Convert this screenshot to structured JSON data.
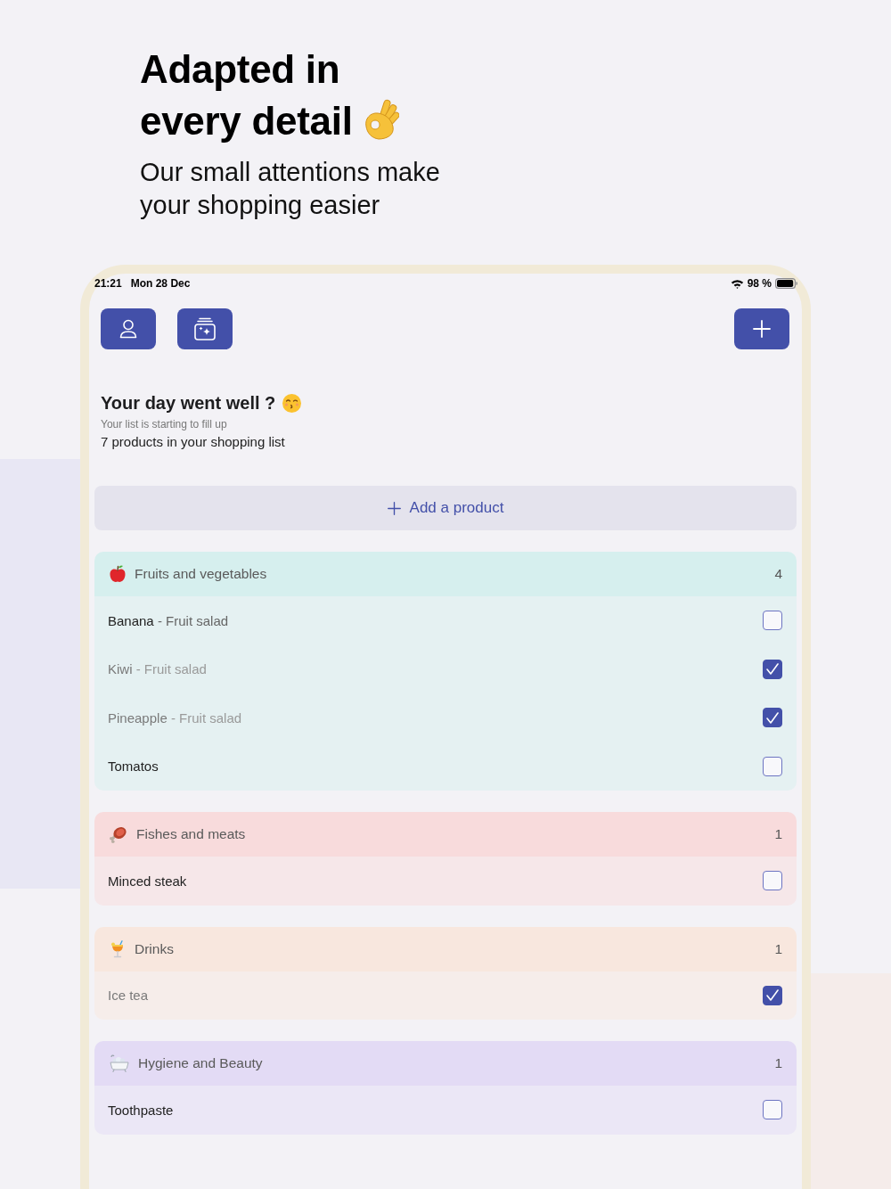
{
  "headline": {
    "title": "Adapted in every detail",
    "subtitle": "Our small attentions make your shopping easier"
  },
  "status_bar": {
    "time": "21:21",
    "date": "Mon 28 Dec",
    "battery": "98 %"
  },
  "greeting": {
    "title": "Your day went well ?",
    "subtitle": "Your list is starting to fill up",
    "summary": "7 products in your shopping list"
  },
  "add_button": {
    "label": "Add a product"
  },
  "categories": [
    {
      "name": "Fruits and vegetables",
      "kind": "fruits",
      "color": "#d6efee",
      "count": "4",
      "items": [
        {
          "name": "Banana",
          "detail": "- Fruit salad",
          "checked": false
        },
        {
          "name": "Kiwi",
          "detail": "- Fruit salad",
          "checked": true
        },
        {
          "name": "Pineapple",
          "detail": "- Fruit salad",
          "checked": true
        },
        {
          "name": "Tomatos",
          "checked": false
        }
      ]
    },
    {
      "name": "Fishes and meats",
      "kind": "meats",
      "color": "#f8dbdc",
      "count": "1",
      "items": [
        {
          "name": "Minced steak",
          "checked": false
        }
      ]
    },
    {
      "name": "Drinks",
      "kind": "drinks",
      "color": "#f8e7de",
      "count": "1",
      "items": [
        {
          "name": "Ice tea",
          "checked": true
        }
      ]
    },
    {
      "name": "Hygiene and Beauty",
      "kind": "hygiene",
      "color": "#e3dbf5",
      "count": "1",
      "items": [
        {
          "name": "Toothpaste",
          "checked": false
        }
      ]
    }
  ]
}
